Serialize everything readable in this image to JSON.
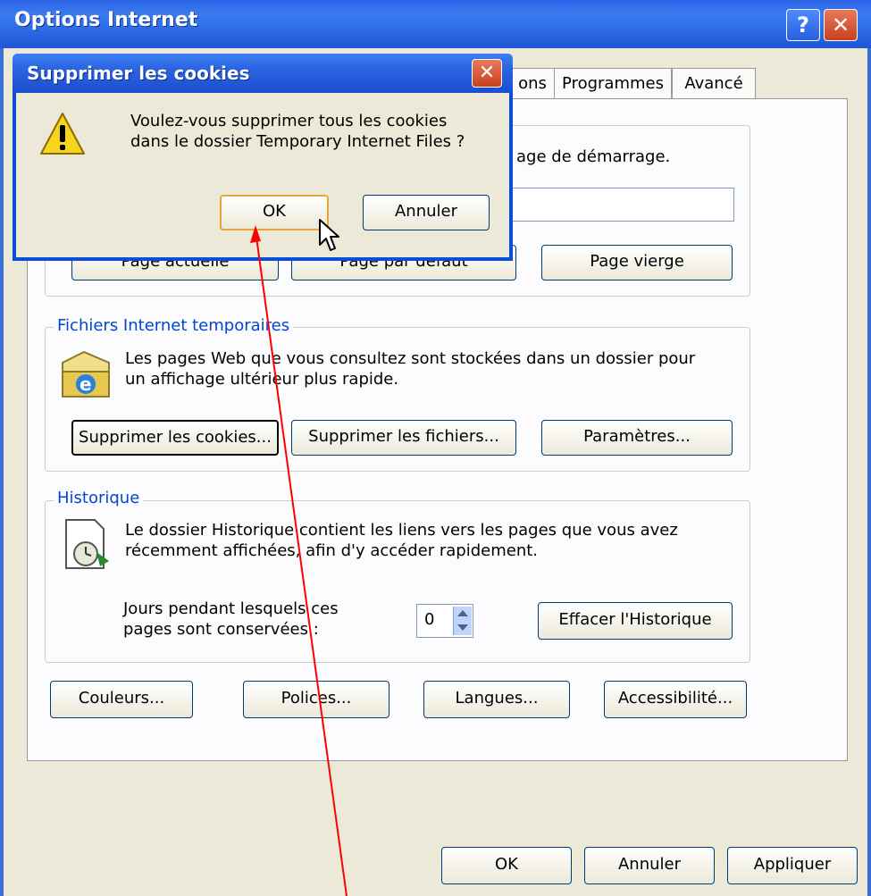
{
  "main_window": {
    "title": "Options Internet",
    "help_icon": "?",
    "close_icon": "✕"
  },
  "tabs": [
    {
      "label": "ons"
    },
    {
      "label": "Programmes"
    },
    {
      "label": "Avancé"
    }
  ],
  "home_page": {
    "partial_text": "age de démarrage.",
    "buttons": {
      "current": "Page actuelle",
      "default": "Page par défaut",
      "blank": "Page vierge"
    }
  },
  "temp_files": {
    "legend": "Fichiers Internet temporaires",
    "description_line1": "Les pages Web que vous consultez sont stockées dans un dossier pour",
    "description_line2": "un affichage ultérieur plus rapide.",
    "buttons": {
      "delete_cookies": "Supprimer les cookies...",
      "delete_files": "Supprimer les fichiers...",
      "settings": "Paramètres..."
    },
    "icon": "ie-folder-icon"
  },
  "history": {
    "legend": "Historique",
    "description_line1": "Le dossier Historique contient les liens vers les pages que vous avez",
    "description_line2": "récemment affichées, afin d'y accéder rapidement.",
    "days_label_line1": "Jours pendant lesquels ces",
    "days_label_line2": "pages sont conservées :",
    "days_value": "0",
    "clear_button": "Effacer l'Historique",
    "icon": "history-clock-icon"
  },
  "bottom_buttons": {
    "colors": "Couleurs...",
    "fonts": "Polices...",
    "languages": "Langues...",
    "accessibility": "Accessibilité..."
  },
  "footer_buttons": {
    "ok": "OK",
    "cancel": "Annuler",
    "apply": "Appliquer"
  },
  "dialog": {
    "title": "Supprimer les cookies",
    "close_icon": "✕",
    "message_line1": "Voulez-vous supprimer tous les cookies",
    "message_line2": "dans le dossier Temporary Internet Files ?",
    "ok": "OK",
    "cancel": "Annuler",
    "icon": "warning-icon"
  },
  "colors": {
    "titlebar": "#2d64e8",
    "window_bg": "#ece9d8",
    "legend_blue": "#0046d5",
    "arrow_red": "#ff0000"
  }
}
